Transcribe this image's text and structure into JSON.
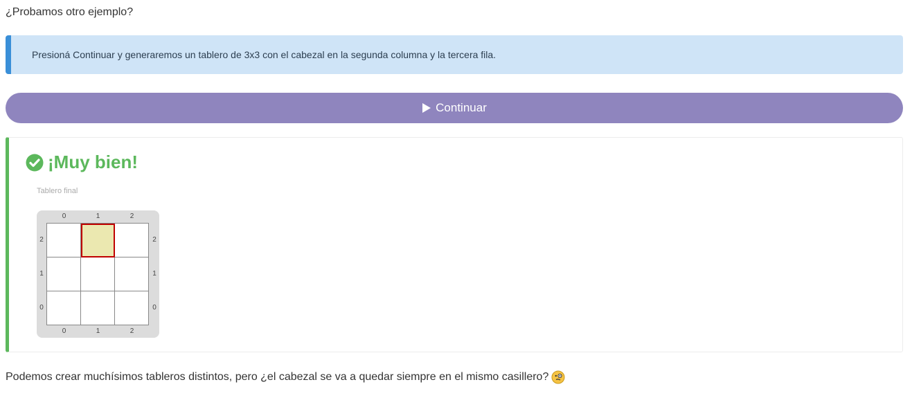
{
  "intro_text": "¿Probamos otro ejemplo?",
  "info_box": {
    "text": "Presioná Continuar y generaremos un tablero de 3x3 con el cabezal en la segunda columna y la tercera fila."
  },
  "continue_button": {
    "label": "Continuar",
    "icon": "play-icon"
  },
  "result": {
    "title": "¡Muy bien!",
    "icon": "check-circle-icon",
    "board_caption": "Tablero final",
    "board": {
      "columns": [
        "0",
        "1",
        "2"
      ],
      "rows": [
        "2",
        "1",
        "0"
      ],
      "head_column": 1,
      "head_row": 2
    }
  },
  "outro_text": "Podemos crear muchísimos tableros distintos, pero ¿el cabezal se va a quedar siempre en el mismo casillero?",
  "colors": {
    "info_bg": "#cfe4f7",
    "info_accent": "#3a8fd8",
    "button_bg": "#8f85be",
    "success": "#5cb85c",
    "head_fill": "#ebe8b0",
    "head_border": "#c00000"
  }
}
